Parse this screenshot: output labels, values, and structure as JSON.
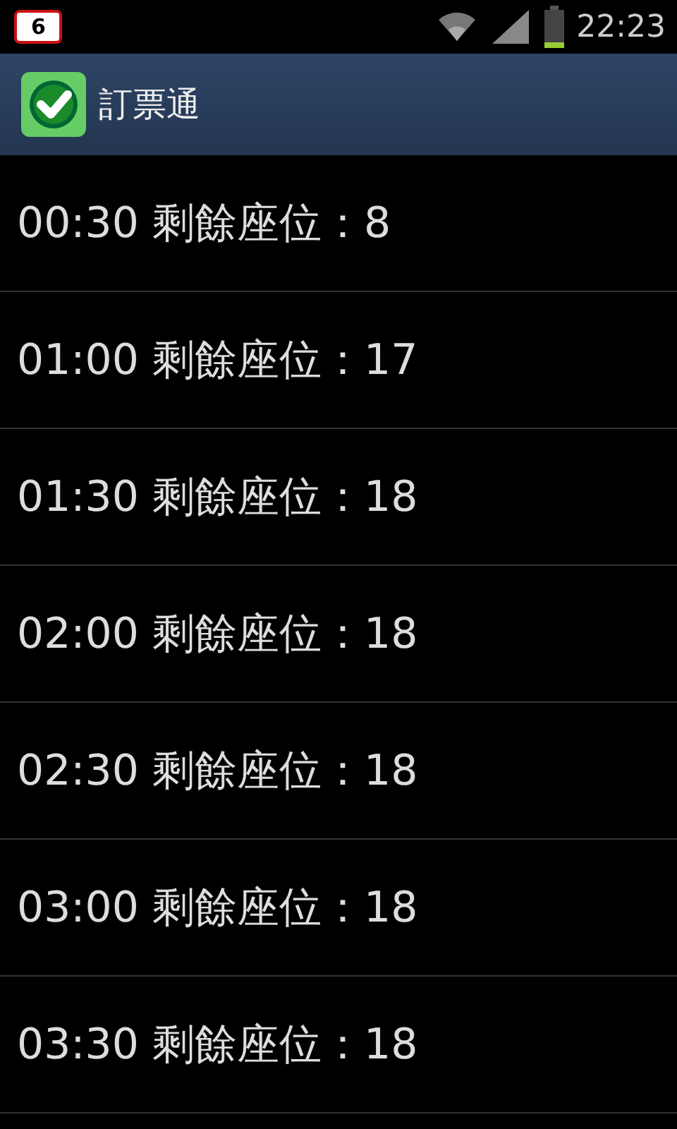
{
  "status_bar": {
    "notification_count": "6",
    "time": "22:23"
  },
  "action_bar": {
    "title": "訂票通"
  },
  "rows": [
    {
      "text": "00:30 剩餘座位：8"
    },
    {
      "text": "01:00 剩餘座位：17"
    },
    {
      "text": "01:30 剩餘座位：18"
    },
    {
      "text": "02:00 剩餘座位：18"
    },
    {
      "text": "02:30 剩餘座位：18"
    },
    {
      "text": "03:00 剩餘座位：18"
    },
    {
      "text": "03:30 剩餘座位：18"
    }
  ]
}
